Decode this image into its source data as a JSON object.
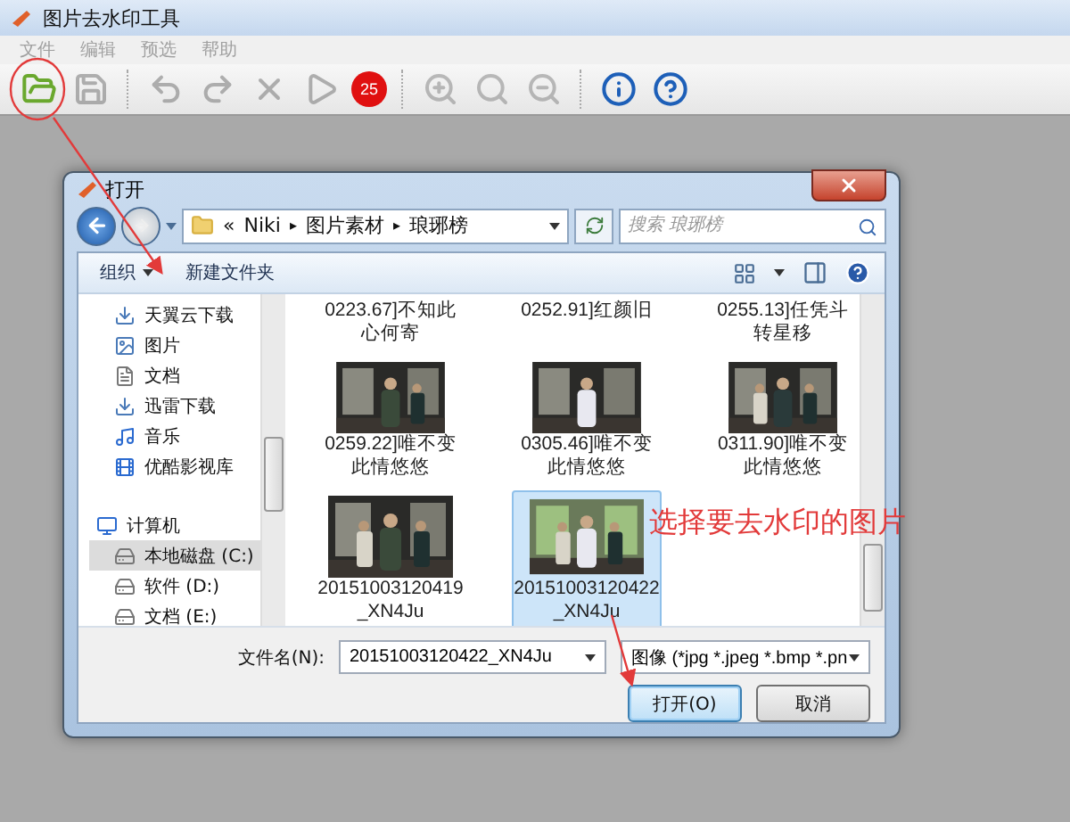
{
  "window": {
    "title": "图片去水印工具"
  },
  "menu": [
    {
      "label": "文件",
      "disabled": true
    },
    {
      "label": "编辑",
      "disabled": true
    },
    {
      "label": "预选",
      "disabled": true
    },
    {
      "label": "帮助",
      "disabled": true
    }
  ],
  "toolbar": [
    {
      "kind": "open",
      "disabled": false
    },
    {
      "kind": "save",
      "disabled": true
    },
    {
      "kind": "separator"
    },
    {
      "kind": "undo",
      "disabled": true
    },
    {
      "kind": "redo",
      "disabled": true
    },
    {
      "kind": "delete",
      "disabled": true
    },
    {
      "kind": "run",
      "disabled": true
    },
    {
      "kind": "badge",
      "label": "25",
      "disabled": false
    },
    {
      "kind": "separator"
    },
    {
      "kind": "zoom_in",
      "disabled": true
    },
    {
      "kind": "zoom_fit",
      "disabled": true
    },
    {
      "kind": "zoom_out",
      "disabled": true
    },
    {
      "kind": "separator"
    },
    {
      "kind": "info",
      "disabled": false
    },
    {
      "kind": "help",
      "disabled": false
    }
  ],
  "dialog": {
    "title": "打开",
    "address": [
      {
        "kind": "overflow",
        "text": "«"
      },
      {
        "kind": "folder",
        "text": "Niki"
      },
      {
        "kind": "separator",
        "text": "▸"
      },
      {
        "kind": "folder",
        "text": "图片素材"
      },
      {
        "kind": "separator",
        "text": "▸"
      },
      {
        "kind": "folder",
        "text": "琅琊榜"
      }
    ],
    "search": {
      "placeholder": "搜索 琅琊榜"
    },
    "commands": [
      {
        "label": "组织",
        "dropdown": true
      },
      {
        "label": "新建文件夹",
        "dropdown": false
      }
    ],
    "nav": [
      {
        "label": "天翼云下载",
        "kind": "download",
        "selected": false
      },
      {
        "label": "图片",
        "kind": "pictures",
        "selected": false
      },
      {
        "label": "文档",
        "kind": "documents",
        "selected": false
      },
      {
        "label": "迅雷下载",
        "kind": "download",
        "selected": false
      },
      {
        "label": "音乐",
        "kind": "music",
        "selected": false
      },
      {
        "label": "优酷影视库",
        "kind": "video",
        "selected": false
      },
      {
        "label": "计算机",
        "kind": "computer",
        "selected": false
      },
      {
        "label": "本地磁盘 (C:)",
        "kind": "drive",
        "selected": true
      },
      {
        "label": "软件 (D:)",
        "kind": "drive",
        "selected": false
      },
      {
        "label": "文档 (E:)",
        "kind": "drive",
        "selected": false
      }
    ],
    "files": [
      {
        "name": "0223.67]不知此心何寄",
        "thumbnail": false,
        "selected": false
      },
      {
        "name": "0252.91]红颜旧",
        "thumbnail": false,
        "selected": false
      },
      {
        "name": "0255.13]任凭斗转星移",
        "thumbnail": false,
        "selected": false
      },
      {
        "name": "0259.22]唯不变此情悠悠",
        "thumbnail": true,
        "selected": false
      },
      {
        "name": "0305.46]唯不变此情悠悠",
        "thumbnail": true,
        "selected": false
      },
      {
        "name": "0311.90]唯不变此情悠悠",
        "thumbnail": true,
        "selected": false
      },
      {
        "name": "20151003120419_XN4Ju",
        "thumbnail": true,
        "selected": false
      },
      {
        "name": "20151003120422_XN4Ju",
        "thumbnail": true,
        "selected": true
      }
    ],
    "filename_label": "文件名(N):",
    "filename": "20151003120422_XN4Ju",
    "filter": "图像 (*jpg *.jpeg *.bmp *.pn",
    "buttons": [
      {
        "label": "打开(O)",
        "default": true
      },
      {
        "label": "取消",
        "default": false
      }
    ]
  },
  "annotation": {
    "text": "选择要去水印的图片"
  }
}
